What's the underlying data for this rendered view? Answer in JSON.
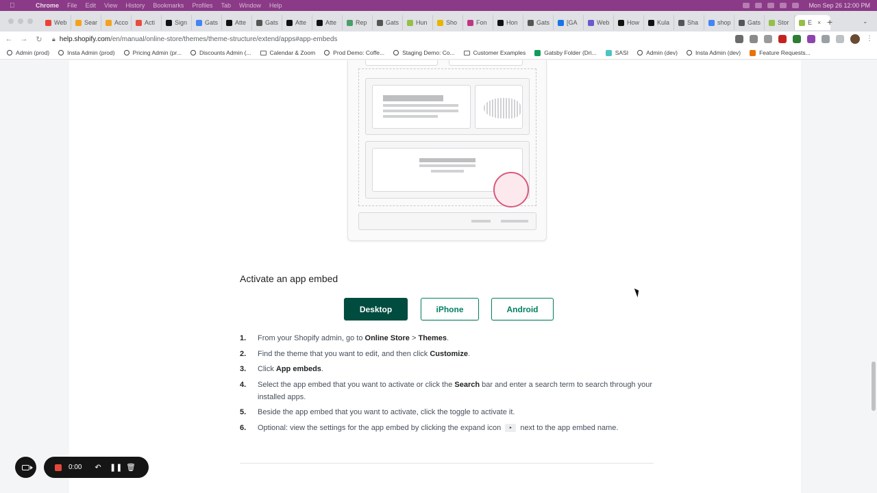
{
  "menubar": {
    "app": "Chrome",
    "items": [
      "File",
      "Edit",
      "View",
      "History",
      "Bookmarks",
      "Profiles",
      "Tab",
      "Window",
      "Help"
    ],
    "clock": "Mon Sep 26  12:00 PM"
  },
  "tabs": [
    {
      "label": "Web",
      "color": "#ea4335"
    },
    {
      "label": "Sear",
      "color": "#f4a21c"
    },
    {
      "label": "Acco",
      "color": "#f4a21c"
    },
    {
      "label": "Acti",
      "color": "#e84d3d"
    },
    {
      "label": "Sign",
      "color": "#111111"
    },
    {
      "label": "Gats",
      "color": "#4285f4"
    },
    {
      "label": "Atte",
      "color": "#111111"
    },
    {
      "label": "Gats",
      "color": "#555555"
    },
    {
      "label": "Atte",
      "color": "#111111"
    },
    {
      "label": "Atte",
      "color": "#111111"
    },
    {
      "label": "Rep",
      "color": "#4a9e6b"
    },
    {
      "label": "Gats",
      "color": "#555555"
    },
    {
      "label": "Hun",
      "color": "#95bf47"
    },
    {
      "label": "Sho",
      "color": "#e8b600"
    },
    {
      "label": "Fon",
      "color": "#c13584"
    },
    {
      "label": "Hon",
      "color": "#111111"
    },
    {
      "label": "Gats",
      "color": "#555555"
    },
    {
      "label": "[GA",
      "color": "#1a73e8"
    },
    {
      "label": "Web",
      "color": "#6a5acd"
    },
    {
      "label": "How",
      "color": "#111111"
    },
    {
      "label": "Kula",
      "color": "#111111"
    },
    {
      "label": "Sha",
      "color": "#555555"
    },
    {
      "label": "shop",
      "color": "#4285f4"
    },
    {
      "label": "Gats",
      "color": "#555555"
    },
    {
      "label": "Stor",
      "color": "#95bf47"
    }
  ],
  "active_tab": {
    "label": "E",
    "color": "#95bf47"
  },
  "url": {
    "host": "help.shopify.com",
    "path": "/en/manual/online-store/themes/theme-structure/extend/apps#app-embeds"
  },
  "bookmarks": [
    {
      "label": "Admin (prod)",
      "kind": "gatsby"
    },
    {
      "label": "Insta Admin (prod)",
      "kind": "gatsby"
    },
    {
      "label": "Pricing Admin (pr...",
      "kind": "gatsby"
    },
    {
      "label": "Discounts Admin (...",
      "kind": "gatsby"
    },
    {
      "label": "Calendar & Zoom",
      "kind": "folder"
    },
    {
      "label": "Prod Demo: Coffe...",
      "kind": "gatsby"
    },
    {
      "label": "Staging Demo: Co...",
      "kind": "gatsby"
    },
    {
      "label": "Customer Examples",
      "kind": "folder"
    },
    {
      "label": "Gatsby Folder (Dri...",
      "kind": "drive"
    },
    {
      "label": "SASI",
      "kind": "sasi"
    },
    {
      "label": "Admin (dev)",
      "kind": "gatsby"
    },
    {
      "label": "Insta Admin (dev)",
      "kind": "gatsby"
    },
    {
      "label": "Feature Requests...",
      "kind": "feature"
    }
  ],
  "article": {
    "heading": "Activate an app embed",
    "platform_tabs": [
      "Desktop",
      "iPhone",
      "Android"
    ],
    "selected_platform": "Desktop",
    "steps": [
      {
        "n": "1.",
        "parts": [
          {
            "t": "From your Shopify admin, go to "
          },
          {
            "t": "Online Store",
            "b": true
          },
          {
            "t": " > "
          },
          {
            "t": "Themes",
            "b": true
          },
          {
            "t": "."
          }
        ]
      },
      {
        "n": "2.",
        "parts": [
          {
            "t": "Find the theme that you want to edit, and then click "
          },
          {
            "t": "Customize",
            "b": true
          },
          {
            "t": "."
          }
        ]
      },
      {
        "n": "3.",
        "parts": [
          {
            "t": "Click "
          },
          {
            "t": "App embeds",
            "b": true
          },
          {
            "t": "."
          }
        ]
      },
      {
        "n": "4.",
        "parts": [
          {
            "t": "Select the app embed that you want to activate or click the "
          },
          {
            "t": "Search",
            "b": true
          },
          {
            "t": " bar and enter a search term to search through your installed apps."
          }
        ]
      },
      {
        "n": "5.",
        "parts": [
          {
            "t": "Beside the app embed that you want to activate, click the toggle to activate it."
          }
        ]
      },
      {
        "n": "6.",
        "parts": [
          {
            "t": "Optional: view the settings for the app embed by clicking the expand icon "
          },
          {
            "icon": "expand-icon"
          },
          {
            "t": " next to the app embed name."
          }
        ]
      }
    ]
  },
  "recorder": {
    "time": "0:00"
  },
  "colors": {
    "accent": "#008060",
    "accent_dark": "#004c3f",
    "highlight": "#d9577a"
  }
}
